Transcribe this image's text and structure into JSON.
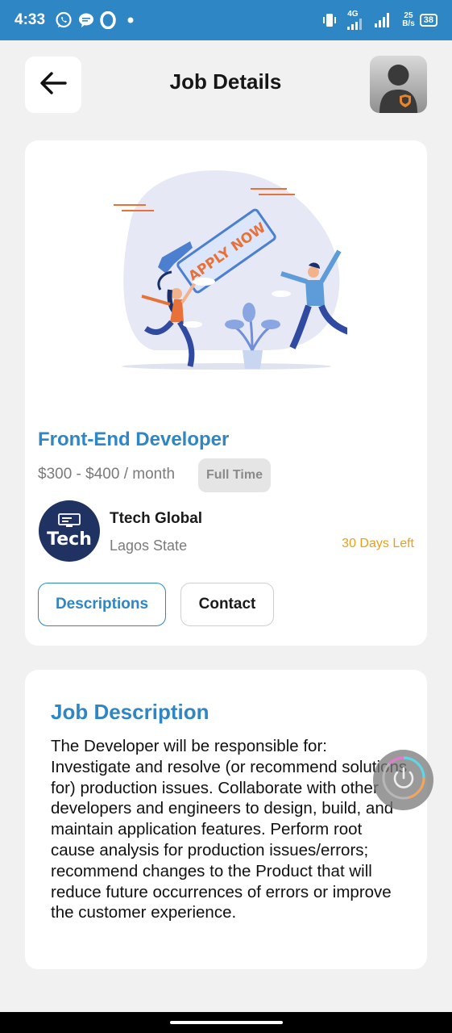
{
  "status_bar": {
    "time": "4:33",
    "network_type": "4G",
    "data_speed_value": "25",
    "data_speed_unit": "B/s",
    "battery": "38",
    "icons": [
      "whatsapp-icon",
      "chat-bubble-icon",
      "opera-icon",
      "dot-icon",
      "vibrate-icon",
      "signal-icon",
      "signal-icon"
    ]
  },
  "header": {
    "title": "Job Details",
    "back_icon": "arrow-left-icon",
    "avatar_icon": "user-avatar-icon"
  },
  "job": {
    "illustration_text": "APPLY NOW",
    "title": "Front-End Developer",
    "salary": "$300 - $400 / month",
    "type": "Full Time",
    "company": {
      "logo_text": "Tech",
      "name": "Ttech Global",
      "location": "Lagos State"
    },
    "days_left": "30 Days Left",
    "tabs": [
      {
        "label": "Descriptions",
        "active": true
      },
      {
        "label": "Contact",
        "active": false
      }
    ]
  },
  "description": {
    "heading": "Job Description",
    "body": "The Developer will be responsible for: Investigate and resolve (or recommend solutions for) production issues. Collaborate with other developers and engineers to design, build, and maintain application features. Perform root cause analysis for production issues/errors; recommend changes to the Product that will reduce future occurrences of errors or improve the customer experience."
  },
  "floating_button": {
    "icon": "power-icon"
  },
  "colors": {
    "status_bar": "#2f86c4",
    "accent": "#2f86c4",
    "warning": "#e6a117",
    "background": "#f1f1f1",
    "logo_bg": "#1f3262"
  }
}
